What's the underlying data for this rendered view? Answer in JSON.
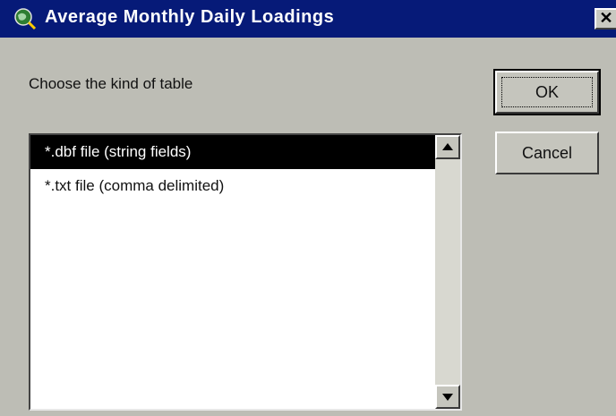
{
  "window": {
    "title": "Average Monthly Daily Loadings",
    "close_label": "✕"
  },
  "prompt": "Choose the kind of table",
  "buttons": {
    "ok": "OK",
    "cancel": "Cancel"
  },
  "list": {
    "items": [
      {
        "label": "*.dbf file (string fields)",
        "selected": true
      },
      {
        "label": "*.txt file (comma delimited)",
        "selected": false
      }
    ]
  }
}
